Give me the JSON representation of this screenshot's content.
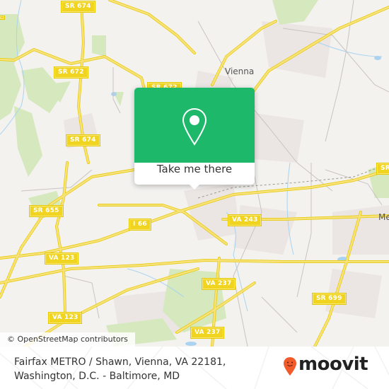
{
  "map": {
    "road_shields": [
      {
        "label": "SR 674",
        "id": "sr674-top"
      },
      {
        "label": "SR 672",
        "id": "sr672-left"
      },
      {
        "label": "SR 672",
        "id": "sr672-mid"
      },
      {
        "label": "SR 674",
        "id": "sr674-mid"
      },
      {
        "label": "SR 655",
        "id": "sr655"
      },
      {
        "label": "I 66",
        "id": "i66"
      },
      {
        "label": "VA 123",
        "id": "va123-a"
      },
      {
        "label": "VA 123",
        "id": "va123-b"
      },
      {
        "label": "VA 243",
        "id": "va243"
      },
      {
        "label": "VA 237",
        "id": "va237-a"
      },
      {
        "label": "VA 237",
        "id": "va237-b"
      },
      {
        "label": "SR 699",
        "id": "sr699"
      },
      {
        "label": "SR",
        "id": "sr-right"
      }
    ],
    "places": [
      {
        "label": "Vienna"
      },
      {
        "label": "Me"
      }
    ],
    "attribution": "© OpenStreetMap contributors",
    "colors": {
      "road": "#f5dc55",
      "land": "#f3f2ef",
      "park": "#d6e8bd",
      "urban": "#ebe5e3",
      "water": "#a9d3f0"
    }
  },
  "popup": {
    "icon": "map-pin-icon",
    "button_label": "Take me there",
    "color": "#1db86a"
  },
  "footer": {
    "address_line1": "Fairfax METRO / Shawn, Vienna, VA 22181,",
    "address_line2": "Washington, D.C. - Baltimore, MD",
    "brand": "moovit",
    "brand_color": "#f15a2b"
  }
}
